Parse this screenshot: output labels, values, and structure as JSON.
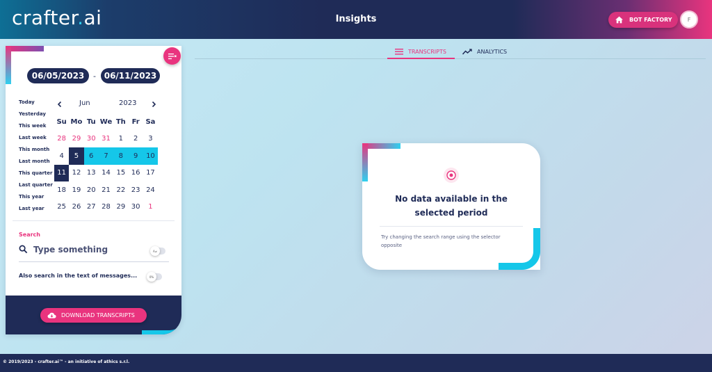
{
  "header": {
    "logo_text": "crafter",
    "logo_dot": ".",
    "logo_suffix": "ai",
    "title": "Insights",
    "bot_factory_label": "BOT FACTORY",
    "avatar_initial": "F"
  },
  "date_range": {
    "start": "06/05/2023",
    "separator": "-",
    "end": "06/11/2023"
  },
  "presets": [
    "Today",
    "Yesterday",
    "This week",
    "Last week",
    "This month",
    "Last month",
    "This quarter",
    "Last quarter",
    "This year",
    "Last year"
  ],
  "calendar": {
    "month": "Jun",
    "year": "2023",
    "weekdays": [
      "Su",
      "Mo",
      "Tu",
      "We",
      "Th",
      "Fr",
      "Sa"
    ],
    "weeks": [
      [
        {
          "d": "28",
          "t": "prev"
        },
        {
          "d": "29",
          "t": "prev"
        },
        {
          "d": "30",
          "t": "prev"
        },
        {
          "d": "31",
          "t": "prev"
        },
        {
          "d": "1",
          "t": ""
        },
        {
          "d": "2",
          "t": ""
        },
        {
          "d": "3",
          "t": ""
        }
      ],
      [
        {
          "d": "4",
          "t": ""
        },
        {
          "d": "5",
          "t": "sel"
        },
        {
          "d": "6",
          "t": "range"
        },
        {
          "d": "7",
          "t": "range"
        },
        {
          "d": "8",
          "t": "range"
        },
        {
          "d": "9",
          "t": "range"
        },
        {
          "d": "10",
          "t": "range"
        }
      ],
      [
        {
          "d": "11",
          "t": "sel"
        },
        {
          "d": "12",
          "t": ""
        },
        {
          "d": "13",
          "t": ""
        },
        {
          "d": "14",
          "t": ""
        },
        {
          "d": "15",
          "t": ""
        },
        {
          "d": "16",
          "t": ""
        },
        {
          "d": "17",
          "t": ""
        }
      ],
      [
        {
          "d": "18",
          "t": ""
        },
        {
          "d": "19",
          "t": ""
        },
        {
          "d": "20",
          "t": ""
        },
        {
          "d": "21",
          "t": ""
        },
        {
          "d": "22",
          "t": ""
        },
        {
          "d": "23",
          "t": ""
        },
        {
          "d": "24",
          "t": ""
        }
      ],
      [
        {
          "d": "25",
          "t": ""
        },
        {
          "d": "26",
          "t": ""
        },
        {
          "d": "27",
          "t": ""
        },
        {
          "d": "28",
          "t": ""
        },
        {
          "d": "29",
          "t": ""
        },
        {
          "d": "30",
          "t": ""
        },
        {
          "d": "1",
          "t": "next"
        }
      ]
    ]
  },
  "search": {
    "label": "Search",
    "placeholder": "Type something",
    "case_toggle_label": "A≠",
    "also_label": "Also search in the text of messages...",
    "also_toggle_label": "0%"
  },
  "download_label": "DOWNLOAD TRANSCRIPTS",
  "tabs": {
    "transcripts": "TRANSCRIPTS",
    "analytics": "ANALYTICS"
  },
  "empty_state": {
    "title_line1": "No data available in the",
    "title_line2": "selected period",
    "subtitle": "Try changing the search range using the selector opposite"
  },
  "footer": {
    "text": "© 2019/2023 - crafter.ai™ - an initiative of athics s.r.l."
  },
  "colors": {
    "navy": "#1f2b57",
    "pink": "#e9347e",
    "cyan": "#15c7e9"
  }
}
